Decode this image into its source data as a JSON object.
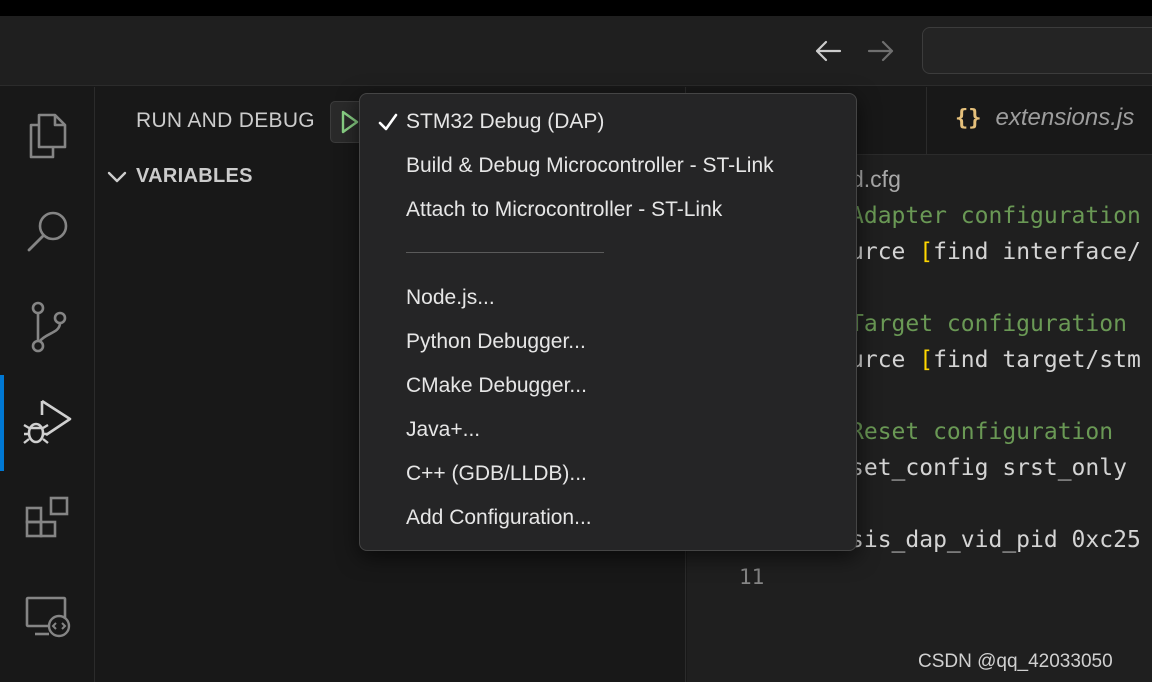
{
  "sidebar": {
    "title": "RUN AND DEBUG",
    "variables_section": "VARIABLES"
  },
  "launch_menu": {
    "selected": "STM32 Debug (DAP)",
    "items": [
      "STM32 Debug (DAP)",
      "Build & Debug Microcontroller - ST-Link",
      "Attach to Microcontroller - ST-Link"
    ],
    "separator": "—",
    "more_items": [
      "Node.js...",
      "Python Debugger...",
      "CMake Debugger...",
      "Java+...",
      "C++ (GDB/LLDB)...",
      "Add Configuration..."
    ]
  },
  "editor": {
    "tab_label": "extensions.js",
    "breadcrumb": "d.cfg",
    "code_lines": [
      {
        "kind": "comment",
        "text": "Adapter configuration"
      },
      {
        "kind": "source",
        "prefix": "urce ",
        "bracket": "[",
        "rest": "find interface/"
      },
      {
        "kind": "comment",
        "text": "Target configuration"
      },
      {
        "kind": "source",
        "prefix": "urce ",
        "bracket": "[",
        "rest": "find target/stm"
      },
      {
        "kind": "comment",
        "text": "Reset configuration"
      },
      {
        "kind": "plain",
        "text": "set_config srst_only"
      },
      {
        "kind": "plain",
        "text": "sis_dap_vid_pid 0xc25"
      }
    ],
    "visible_line_number": "11"
  },
  "watermark": "CSDN @qq_42033050",
  "colors": {
    "accent": "#0078d4",
    "comment": "#6a9955",
    "bracket": "#ffd700",
    "run_icon": "#89d185",
    "json_icon": "#e5c07b"
  },
  "icons": [
    "explorer-icon",
    "search-icon",
    "source-control-icon",
    "run-debug-icon",
    "extensions-icon",
    "remote-explorer-icon",
    "back-arrow-icon",
    "forward-arrow-icon",
    "play-icon",
    "chevron-down-icon",
    "checkmark-icon",
    "json-icon"
  ]
}
